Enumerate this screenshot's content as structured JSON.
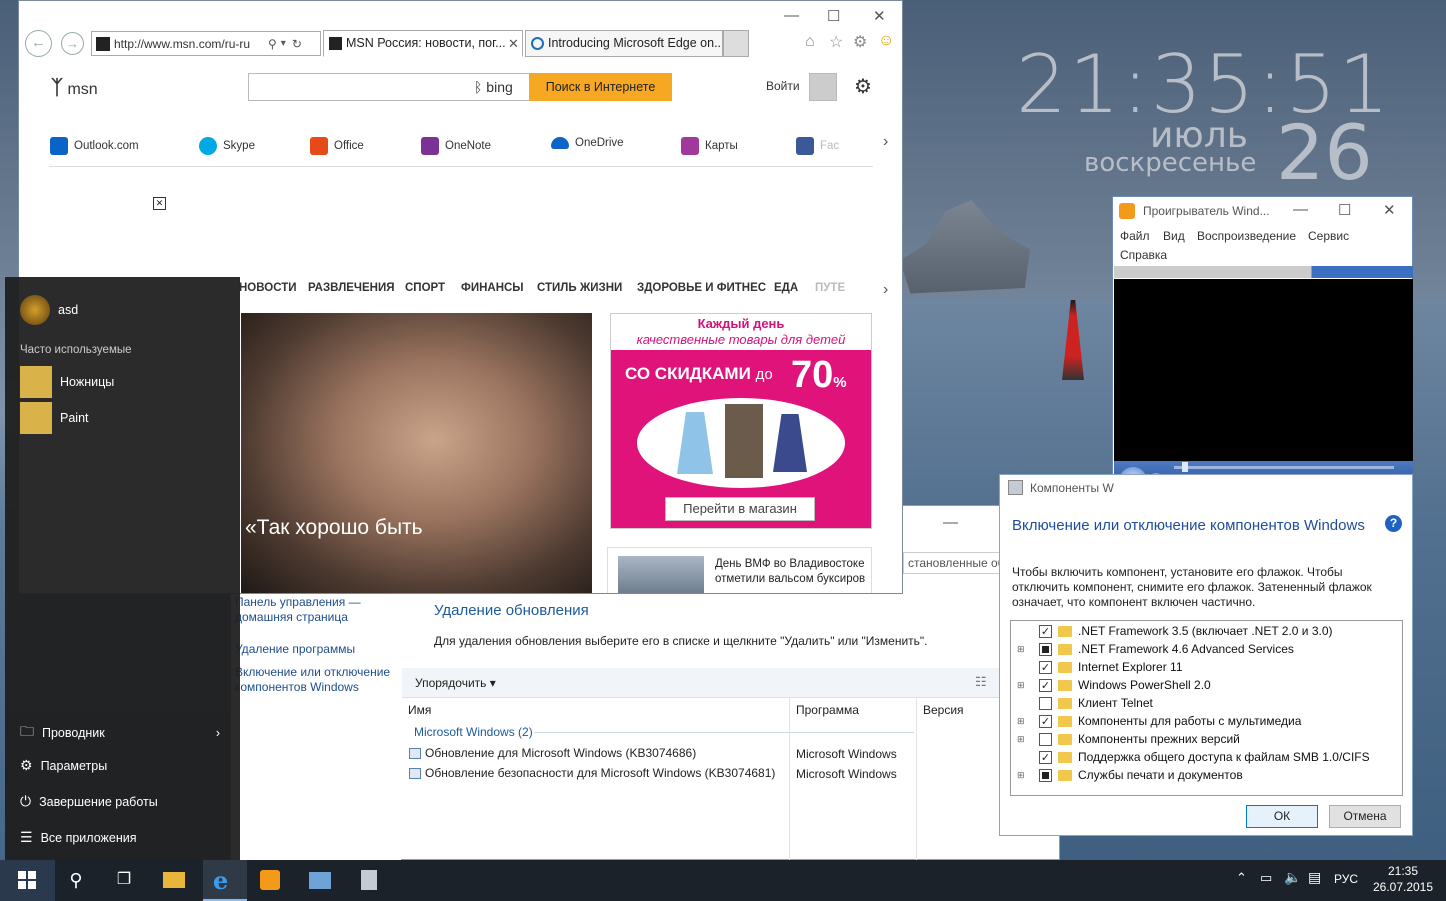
{
  "desktop": {
    "clock_time": "21:35:51",
    "clock_month": "июль",
    "clock_dow": "воскресенье",
    "clock_day": "26"
  },
  "ie": {
    "address": "http://www.msn.com/ru-ru",
    "tabs": [
      {
        "label": "MSN Россия: новости, пог...",
        "active": true
      },
      {
        "label": "Introducing Microsoft Edge on...",
        "active": false
      }
    ],
    "search_placeholder": "",
    "bing_label": "bing",
    "search_button": "Поиск в Интернете",
    "signin": "Войти",
    "logo": "msn",
    "quick_links": [
      "Outlook.com",
      "Skype",
      "Office",
      "OneNote",
      "OneDrive",
      "Карты",
      "Fac"
    ],
    "categories": [
      "НОВОСТИ",
      "РАЗВЛЕЧЕНИЯ",
      "СПОРТ",
      "ФИНАНСЫ",
      "СТИЛЬ ЖИЗНИ",
      "ЗДОРОВЬЕ И ФИТНЕС",
      "ЕДА",
      "ПУТЕ"
    ],
    "hero_caption": "«Так хорошо быть",
    "ad": {
      "line1": "Каждый день",
      "line2": "качественные товары для детей",
      "discount_text": "СО СКИДКАМИ",
      "discount_prefix": "до",
      "discount_value": "70",
      "discount_unit": "%",
      "button": "Перейти в магазин"
    },
    "news2": "День ВМФ во Владивостоке отметили вальсом буксиров"
  },
  "start": {
    "user": "asd",
    "section": "Часто используемые",
    "apps": [
      "Ножницы",
      "Paint"
    ],
    "bottom": [
      "Проводник",
      "Параметры",
      "Завершение работы",
      "Все приложения"
    ]
  },
  "control_panel": {
    "left_links": [
      "Панель управления — домашняя страница",
      "Удаление программы",
      "Включение или отключение компонентов Windows"
    ],
    "breadcrumb_fragment": "становленные об",
    "title": "Удаление обновления",
    "description": "Для удаления обновления выберите его в списке и щелкните \"Удалить\" или \"Изменить\".",
    "organize": "Упорядочить",
    "columns": [
      "Имя",
      "Программа",
      "Версия"
    ],
    "group": "Microsoft Windows (2)",
    "rows": [
      {
        "name": "Обновление для Microsoft Windows (KB3074686)",
        "program": "Microsoft Windows"
      },
      {
        "name": "Обновление безопасности для Microsoft Windows (KB3074681)",
        "program": "Microsoft Windows"
      }
    ]
  },
  "wmp": {
    "title": "Проигрыватель Wind...",
    "menu": [
      "Файл",
      "Вид",
      "Воспроизведение",
      "Сервис",
      "Справка"
    ]
  },
  "features": {
    "window_title": "Компоненты W",
    "heading": "Включение или отключение компонентов Windows",
    "help": "?",
    "instructions": "Чтобы включить компонент, установите его флажок. Чтобы отключить компонент, снимите его флажок. Затененный флажок означает, что компонент включен частично.",
    "items": [
      {
        "label": ".NET Framework 3.5 (включает .NET 2.0 и 3.0)",
        "state": "checked",
        "expand": false
      },
      {
        "label": ".NET Framework 4.6 Advanced Services",
        "state": "partial",
        "expand": true
      },
      {
        "label": "Internet Explorer 11",
        "state": "checked",
        "expand": false
      },
      {
        "label": "Windows PowerShell 2.0",
        "state": "checked",
        "expand": true
      },
      {
        "label": "Клиент Telnet",
        "state": "unchecked",
        "expand": false
      },
      {
        "label": "Компоненты для работы с мультимедиа",
        "state": "checked",
        "expand": true
      },
      {
        "label": "Компоненты прежних версий",
        "state": "unchecked",
        "expand": true
      },
      {
        "label": "Поддержка общего доступа к файлам SMB 1.0/CIFS",
        "state": "checked",
        "expand": false
      },
      {
        "label": "Службы печати и документов",
        "state": "partial",
        "expand": true
      }
    ],
    "ok": "ОК",
    "cancel": "Отмена"
  },
  "taskbar": {
    "lang": "РУС",
    "time": "21:35",
    "date": "26.07.2015"
  }
}
